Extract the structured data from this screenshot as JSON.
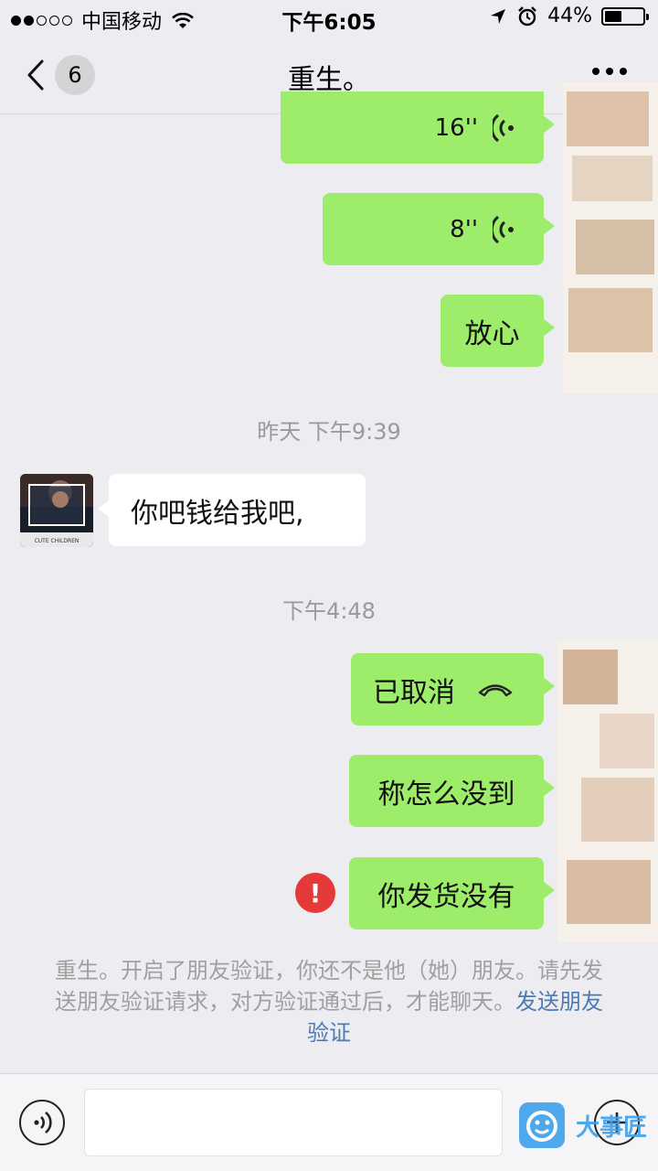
{
  "status_bar": {
    "carrier": "中国移动",
    "time": "下午6:05",
    "battery": "44%",
    "battery_level": 0.44,
    "signal_bars": 2
  },
  "nav": {
    "unread_count": "6",
    "title": "重生。"
  },
  "messages": [
    {
      "side": "me",
      "type": "voice",
      "text": "16''"
    },
    {
      "side": "me",
      "type": "voice",
      "text": "8''"
    },
    {
      "side": "me",
      "type": "text",
      "text": "放心"
    },
    {
      "type": "timestamp",
      "text": "昨天 下午9:39"
    },
    {
      "side": "them",
      "type": "text",
      "text": "你吧钱给我吧,"
    },
    {
      "type": "timestamp",
      "text": "下午4:48"
    },
    {
      "side": "me",
      "type": "call",
      "text": "已取消"
    },
    {
      "side": "me",
      "type": "text",
      "text": "称怎么没到"
    },
    {
      "side": "me",
      "type": "text",
      "text": "你发货没有",
      "failed": true
    }
  ],
  "avatar": {
    "caption": "CUTE CHILDREN"
  },
  "system_notice": {
    "text": "重生。开启了朋友验证，你还不是他（她）朋友。请先发送朋友验证请求，对方验证通过后，才能聊天。",
    "link": "发送朋友验证"
  },
  "watermark": {
    "text": "大事匠"
  },
  "colors": {
    "my_bubble": "#9ded6b",
    "their_bubble": "#ffffff",
    "background": "#edecf1",
    "error": "#e5393a",
    "link": "#4b7bb7"
  }
}
